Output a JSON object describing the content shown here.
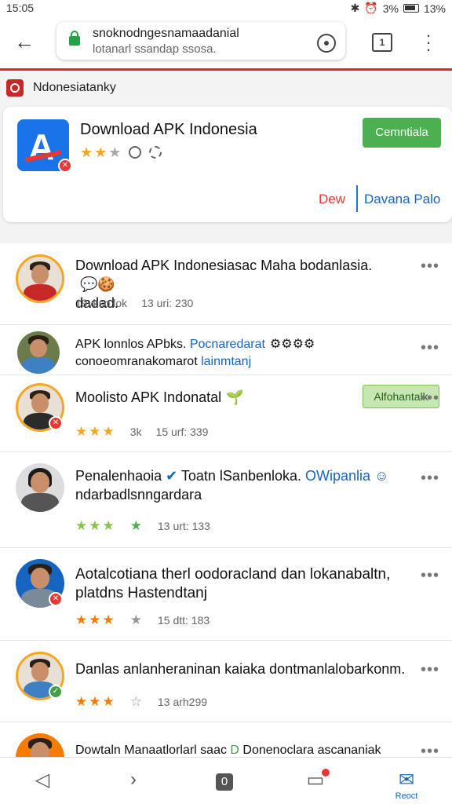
{
  "status": {
    "time": "15:05",
    "battery": "13%",
    "signal": "3%"
  },
  "browser": {
    "url_main": "snoknodngesnamaadanial",
    "url_sub": "lotanarl ssandap ssosa.",
    "tabs_count": "1"
  },
  "site": {
    "name": "Ndonesiatanky"
  },
  "app": {
    "title": "Download APK Indonesia",
    "rating_filled": "★★",
    "rating_empty": "★",
    "download_label": "Cemntiala",
    "link_red": "Dew",
    "link_blue": "Davana Palo"
  },
  "posts": [
    {
      "text": "Download APK Indonesiasac Maha bodanlasia. ",
      "text2": "dadad.",
      "meta1": "19vkso lok",
      "meta2": "13 uri: 230"
    },
    {
      "text": "APK lonnlos APbks. ",
      "link": "Pocnaredarat",
      "text2": "conoeomranakomarot ",
      "link2": "lainmtanj"
    },
    {
      "text": "Moolisto APK Indonatal",
      "tag": "Alfohantalk",
      "meta1": "3k",
      "meta2": "15 urf: 339",
      "stars": "★★★"
    },
    {
      "text": "Penalenhaoia",
      "text_b": " Toatn lSanbenloka. ",
      "link": "OWipanlia",
      "text2": "ndarbadlsnngardara",
      "meta2": "13 urt: 133",
      "stars": "★★★"
    },
    {
      "text": "Aotalcotiana therl oodoracland dan lokanabaltn,",
      "text2": "platdns Hastendtanj",
      "meta2": "15 dtt: 183",
      "stars": "★★★"
    },
    {
      "text": "Danlas anlanheraninan kaiaka dontmanlalobarkonm.",
      "meta2": "13 arh299",
      "stars": "★★★"
    },
    {
      "text": "Dowtaln Manaatlorlarl saac ",
      "link": "D",
      "text_b": " Donenoclara ascananiak",
      "text2": "..."
    }
  ],
  "nav": {
    "tab_counter": "0",
    "reader_label": "Reoct"
  },
  "colors": {
    "accent_red": "#e0262a",
    "link_blue": "#1565c0",
    "star_orange": "#f5a623",
    "star_green": "#4caf50"
  },
  "icons": [
    "back-arrow-icon",
    "lock-icon",
    "refresh-icon",
    "tabs-icon",
    "overflow-menu-icon",
    "star-icon",
    "more-icon",
    "triangle-back-icon",
    "chevron-forward-icon",
    "mail-icon",
    "notification-icon"
  ]
}
